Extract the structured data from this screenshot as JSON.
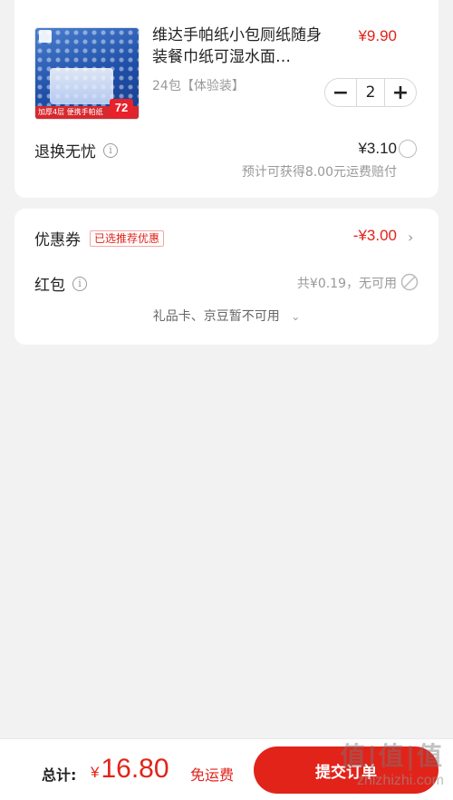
{
  "product": {
    "title": "维达手帕纸小包厕纸随身装餐巾纸可湿水面…",
    "spec": "24包【体验装】",
    "price": "¥9.90",
    "quantity": "2",
    "minus_label": "−",
    "plus_label": "+",
    "image": {
      "icon": "tissue-package-image",
      "bottom_text": "加厚4层  便携手帕纸",
      "count_badge": "72"
    }
  },
  "return_service": {
    "label": "退换无忧",
    "info_icon": "info-icon",
    "price": "¥3.10",
    "compensation": "预计可获得8.00元运费赔付"
  },
  "coupon": {
    "label": "优惠券",
    "tag": "已选推荐优惠",
    "value": "-¥3.00",
    "chevron": "›"
  },
  "red_packet": {
    "label": "红包",
    "info": "共¥0.19，无可用"
  },
  "gift_card": {
    "text": "礼品卡、京豆暂不可用",
    "chevron": "⌄"
  },
  "bottom_bar": {
    "total_label": "总计:",
    "currency": "¥",
    "total": "16.80",
    "shipping": "免运费",
    "submit_label": "提交订单"
  },
  "watermark": {
    "logo": "值|值|值",
    "site": "zhizhizhi.com"
  },
  "colors": {
    "accent_red": "#e2231a",
    "muted_text": "#999999",
    "background": "#f2f2f2"
  }
}
